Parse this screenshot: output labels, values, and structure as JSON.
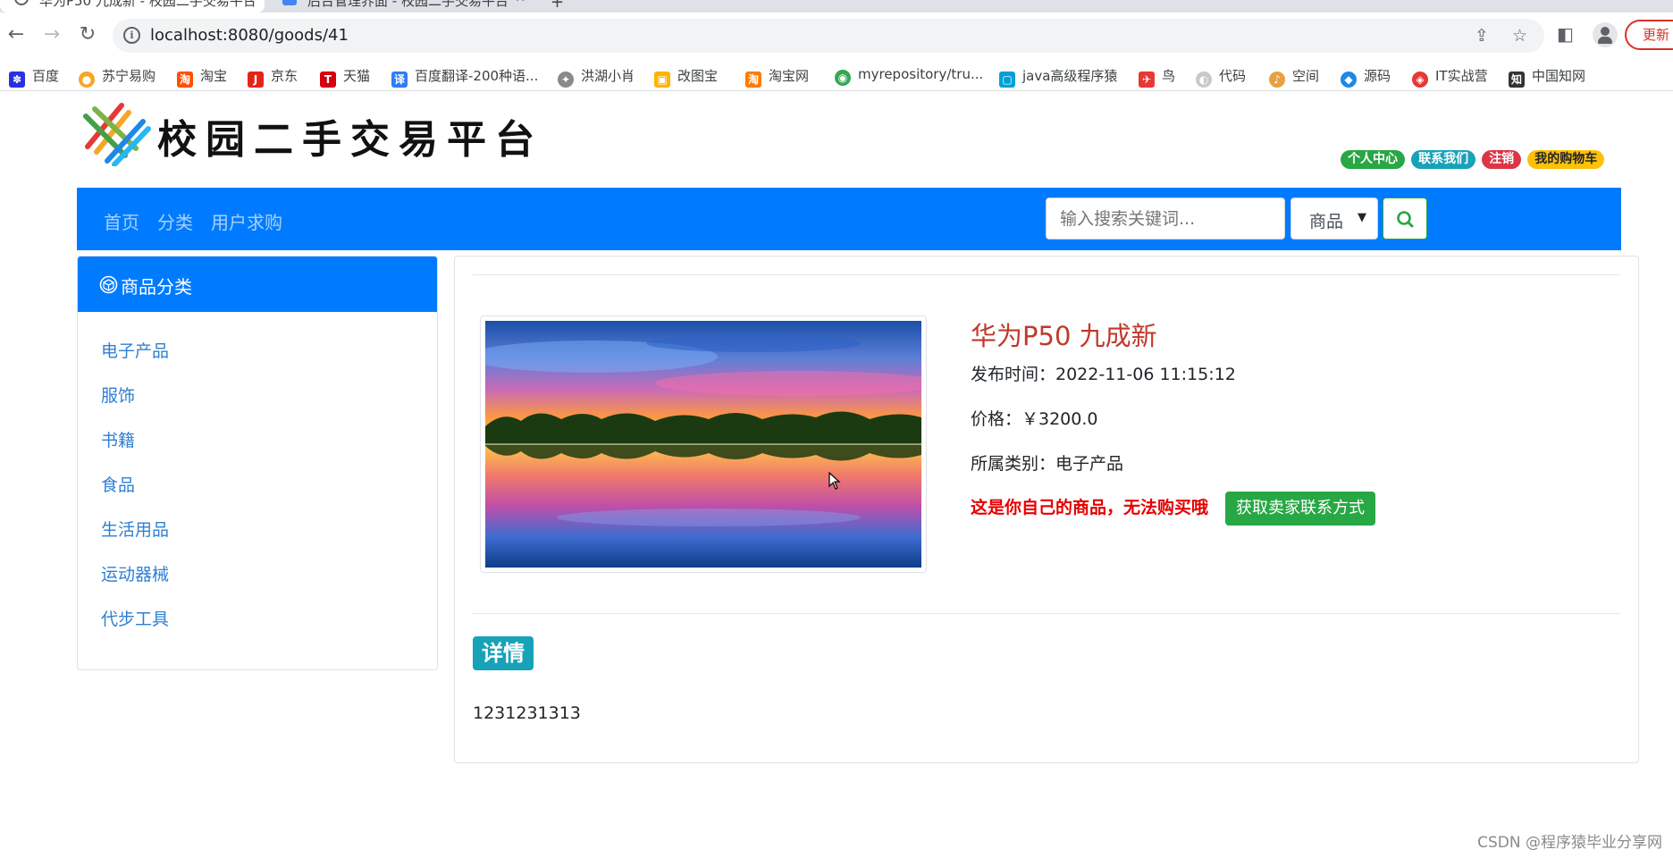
{
  "browser": {
    "tabs": [
      {
        "label": "华为P50 九成新 - 校园二手交易平台"
      },
      {
        "label": "后台管理界面 - 校园二手交易平台"
      }
    ],
    "url": "localhost:8080/goods/41",
    "update_label": "更新",
    "bookmarks": [
      {
        "label": "百度",
        "icon": "baidu-icon",
        "color": "#2932e1"
      },
      {
        "label": "苏宁易购",
        "icon": "suning-icon",
        "color": "#f5a623"
      },
      {
        "label": "淘宝",
        "icon": "taobao-icon",
        "color": "#ff5000"
      },
      {
        "label": "京东",
        "icon": "jd-icon",
        "color": "#e1251b"
      },
      {
        "label": "天猫",
        "icon": "tmall-icon",
        "color": "#d6000f"
      },
      {
        "label": "百度翻译-200种语...",
        "icon": "translate-icon",
        "color": "#2f7cf6"
      },
      {
        "label": "洪湖小肖",
        "icon": "bird-icon",
        "color": "#8a8a8a"
      },
      {
        "label": "改图宝",
        "icon": "image-edit-icon",
        "color": "#ffb300"
      },
      {
        "label": "淘宝网",
        "icon": "taobao-icon",
        "color": "#ff7a00"
      },
      {
        "label": "myrepository/tru...",
        "icon": "chrome-icon",
        "color": "#34a853"
      },
      {
        "label": "java高级程序猿",
        "icon": "bilibili-icon",
        "color": "#00a1d6"
      },
      {
        "label": "鸟",
        "icon": "bird-icon",
        "color": "#e53935"
      },
      {
        "label": "代码",
        "icon": "code-icon",
        "color": "#c9c9c9"
      },
      {
        "label": "空间",
        "icon": "space-icon",
        "color": "#e6a23c"
      },
      {
        "label": "源码",
        "icon": "fish-icon",
        "color": "#1e88e5"
      },
      {
        "label": "IT实战营",
        "icon": "shield-icon",
        "color": "#e53935"
      },
      {
        "label": "中国知网",
        "icon": "cnki-icon",
        "color": "#333333"
      }
    ]
  },
  "site": {
    "logo_text": "校园二手交易平台",
    "user_links": [
      "个人中心",
      "联系我们",
      "注销",
      "我的购物车"
    ],
    "nav": [
      "首页",
      "分类",
      "用户求购"
    ],
    "search": {
      "placeholder": "输入搜索关键词...",
      "type_selected": "商品"
    }
  },
  "sidebar": {
    "title": "商品分类",
    "items": [
      "电子产品",
      "服饰",
      "书籍",
      "食品",
      "生活用品",
      "运动器械",
      "代步工具"
    ]
  },
  "goods": {
    "title": "华为P50 九成新",
    "publish_time": "发布时间：2022-11-06 11:15:12",
    "price": "价格：￥3200.0",
    "category": "所属类别：电子产品",
    "own_note": "这是你自己的商品，无法购买哦",
    "contact_label": "获取卖家联系方式",
    "detail_heading": "详情",
    "detail_text": "1231231313"
  },
  "watermark": "CSDN @程序猿毕业分享网"
}
